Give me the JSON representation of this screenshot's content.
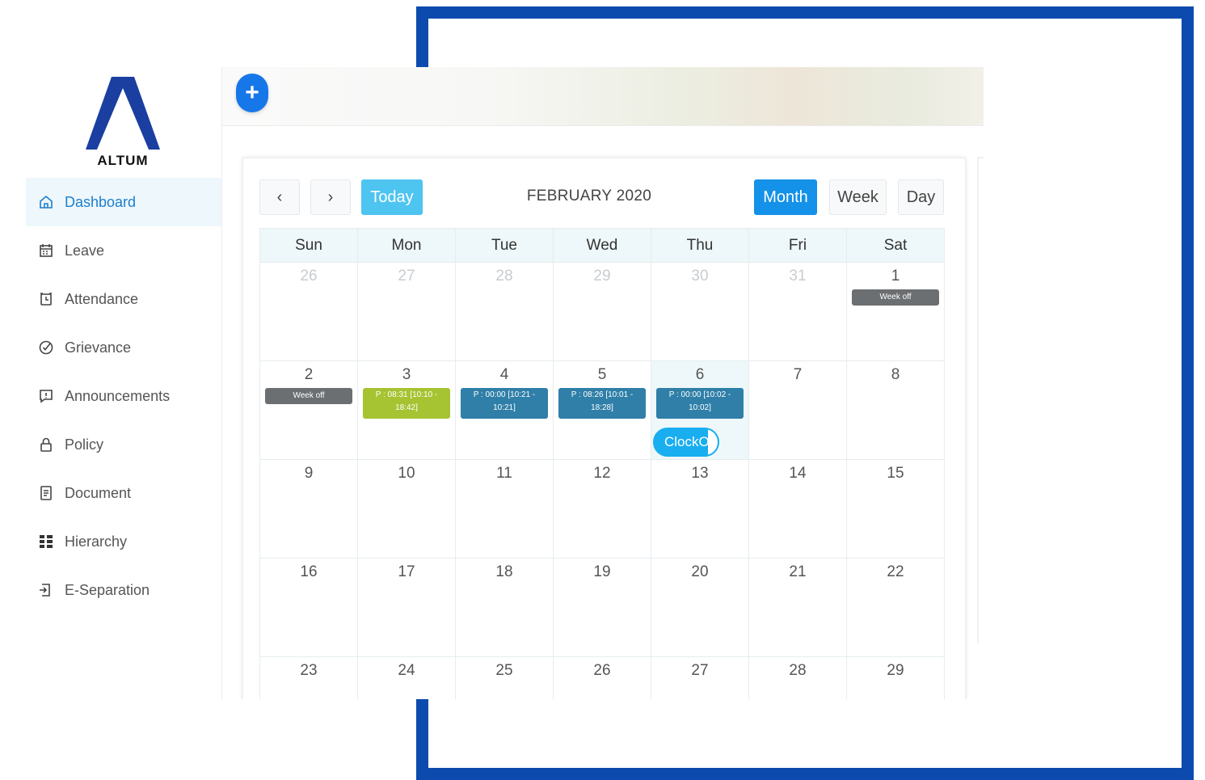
{
  "brand": {
    "logo_text": "ALTUM",
    "color": "#1a3fa0"
  },
  "sidebar": {
    "items": [
      {
        "label": "Dashboard",
        "icon": "home-icon",
        "active": true
      },
      {
        "label": "Leave",
        "icon": "calendar-icon",
        "active": false
      },
      {
        "label": "Attendance",
        "icon": "alarm-clock-icon",
        "active": false
      },
      {
        "label": "Grievance",
        "icon": "check-circle-icon",
        "active": false
      },
      {
        "label": "Announcements",
        "icon": "message-alert-icon",
        "active": false
      },
      {
        "label": "Policy",
        "icon": "lock-icon",
        "active": false
      },
      {
        "label": "Document",
        "icon": "document-icon",
        "active": false
      },
      {
        "label": "Hierarchy",
        "icon": "hierarchy-icon",
        "active": false
      },
      {
        "label": "E-Separation",
        "icon": "exit-icon",
        "active": false
      }
    ]
  },
  "topbar": {
    "add_button": "+"
  },
  "calendar": {
    "title": "FEBRUARY 2020",
    "prev_label": "‹",
    "next_label": "›",
    "today_label": "Today",
    "views": {
      "month": "Month",
      "week": "Week",
      "day": "Day",
      "active": "month"
    },
    "weekdays": [
      "Sun",
      "Mon",
      "Tue",
      "Wed",
      "Thu",
      "Fri",
      "Sat"
    ],
    "weeks": [
      [
        {
          "day": "26",
          "muted": true
        },
        {
          "day": "27",
          "muted": true
        },
        {
          "day": "28",
          "muted": true
        },
        {
          "day": "29",
          "muted": true
        },
        {
          "day": "30",
          "muted": true
        },
        {
          "day": "31",
          "muted": true
        },
        {
          "day": "1",
          "event": {
            "text": "Week off",
            "kind": "gray"
          }
        }
      ],
      [
        {
          "day": "2",
          "event": {
            "text": "Week off",
            "kind": "gray"
          }
        },
        {
          "day": "3",
          "event": {
            "text": "P : 08:31 [10:10 - 18:42]",
            "kind": "lime"
          }
        },
        {
          "day": "4",
          "event": {
            "text": "P : 00:00 [10:21 - 10:21]",
            "kind": "blue"
          }
        },
        {
          "day": "5",
          "event": {
            "text": "P : 08:26 [10:01 - 18:28]",
            "kind": "blue"
          }
        },
        {
          "day": "6",
          "today": true,
          "event": {
            "text": "P : 00:00 [10:02 - 10:02]",
            "kind": "blue"
          },
          "action": "ClockOu"
        },
        {
          "day": "7"
        },
        {
          "day": "8"
        }
      ],
      [
        {
          "day": "9"
        },
        {
          "day": "10"
        },
        {
          "day": "11"
        },
        {
          "day": "12"
        },
        {
          "day": "13"
        },
        {
          "day": "14"
        },
        {
          "day": "15"
        }
      ],
      [
        {
          "day": "16"
        },
        {
          "day": "17"
        },
        {
          "day": "18"
        },
        {
          "day": "19"
        },
        {
          "day": "20"
        },
        {
          "day": "21"
        },
        {
          "day": "22"
        }
      ],
      [
        {
          "day": "23"
        },
        {
          "day": "24"
        },
        {
          "day": "25"
        },
        {
          "day": "26"
        },
        {
          "day": "27"
        },
        {
          "day": "28"
        },
        {
          "day": "29"
        }
      ]
    ]
  },
  "colors": {
    "accent": "#1491e8",
    "today_btn": "#4ec4f0",
    "frame": "#0d4aad",
    "event_blue": "#2f7fa8",
    "event_lime": "#a6c332",
    "event_gray": "#6c6f72"
  }
}
